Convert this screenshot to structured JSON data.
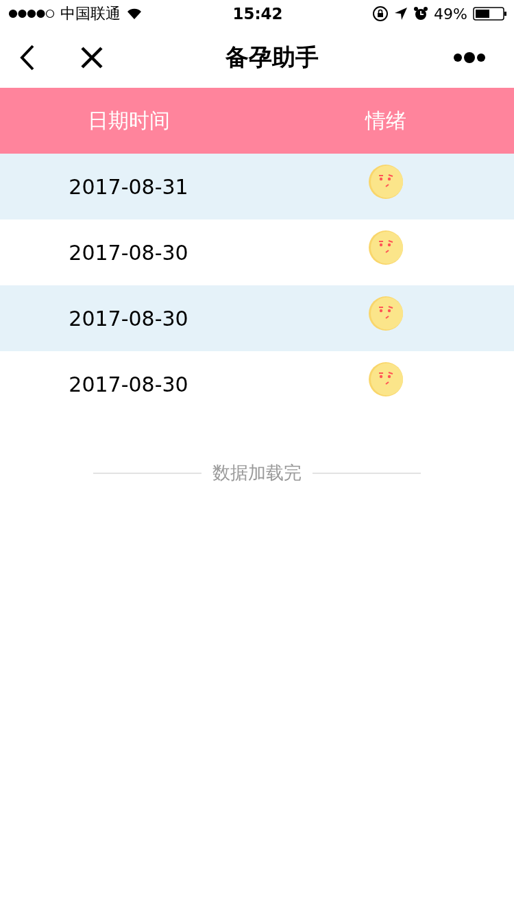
{
  "status_bar": {
    "carrier": "中国联通",
    "time": "15:42",
    "battery": "49%"
  },
  "nav": {
    "title": "备孕助手"
  },
  "table": {
    "columns": [
      "日期时间",
      "情绪"
    ],
    "rows": [
      {
        "date": "2017-08-31"
      },
      {
        "date": "2017-08-30"
      },
      {
        "date": "2017-08-30"
      },
      {
        "date": "2017-08-30"
      }
    ]
  },
  "footer": "数据加载完"
}
